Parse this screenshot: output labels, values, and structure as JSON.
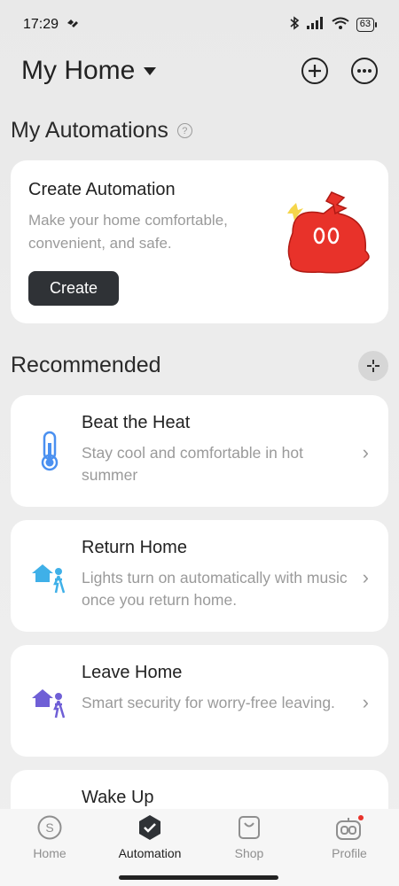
{
  "status_bar": {
    "time": "17:29",
    "battery": "63"
  },
  "header": {
    "title": "My Home"
  },
  "automations": {
    "section_title": "My Automations",
    "create_card": {
      "title": "Create Automation",
      "description": "Make your home comfortable, convenient, and safe.",
      "button_label": "Create"
    }
  },
  "recommended": {
    "section_title": "Recommended",
    "items": [
      {
        "title": "Beat the Heat",
        "description": "Stay cool and comfortable in hot summer",
        "icon": "thermometer-icon"
      },
      {
        "title": "Return Home",
        "description": "Lights turn on automatically with music once you return home.",
        "icon": "return-home-icon"
      },
      {
        "title": "Leave Home",
        "description": "Smart security for worry-free leaving.",
        "icon": "leave-home-icon"
      },
      {
        "title": "Wake Up",
        "description": "",
        "icon": "wake-up-icon"
      }
    ]
  },
  "tabs": [
    {
      "label": "Home",
      "icon": "dollar-circle-icon"
    },
    {
      "label": "Automation",
      "icon": "check-badge-icon",
      "active": true
    },
    {
      "label": "Shop",
      "icon": "shopping-bag-icon"
    },
    {
      "label": "Profile",
      "icon": "robot-face-icon",
      "badge": true
    }
  ],
  "colors": {
    "accent_blue": "#4a90f0",
    "purple": "#6f5fd6",
    "cyan": "#3fb0e8",
    "mascot_red": "#e8322a"
  }
}
